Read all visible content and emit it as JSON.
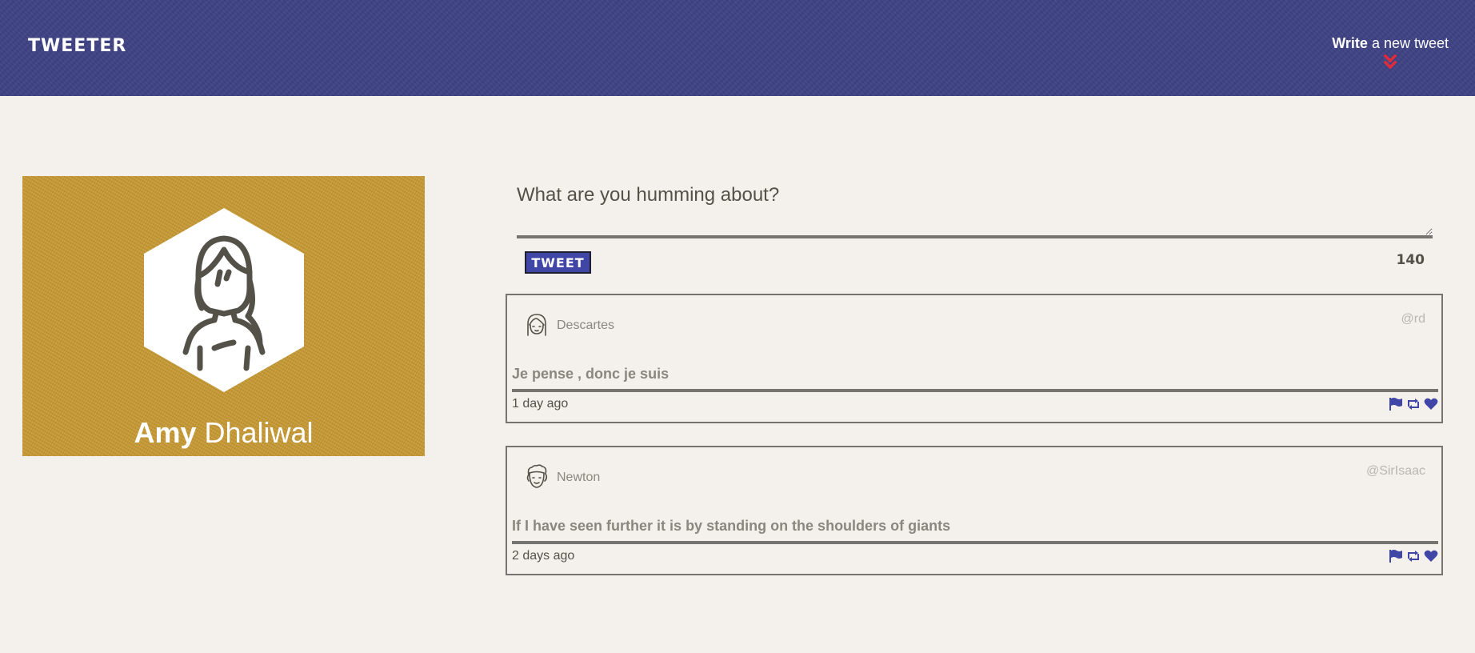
{
  "nav": {
    "brand": "TWEETER",
    "compose_bold": "Write",
    "compose_rest": " a new tweet",
    "compose_icon": "double-chevron-down-icon"
  },
  "profile": {
    "first_name": "Amy",
    "last_name": " Dhaliwal",
    "avatar_icon": "woman-avatar-icon"
  },
  "composer": {
    "placeholder": "What are you humming about?",
    "button_label": "TWEET",
    "counter": "140"
  },
  "tweets": [
    {
      "author": "Descartes",
      "handle": "@rd",
      "text": "Je pense , donc je suis",
      "time": "1 day ago",
      "avatar_icon": "girl-avatar-icon"
    },
    {
      "author": "Newton",
      "handle": "@SirIsaac",
      "text": "If I have seen further it is by standing on the shoulders of giants",
      "time": "2 days ago",
      "avatar_icon": "man-avatar-icon"
    }
  ],
  "action_icons": [
    "flag-icon",
    "retweet-icon",
    "heart-icon"
  ],
  "colors": {
    "nav_bg": "#3f4385",
    "profile_bg": "#c89a33",
    "accent": "#4046a6",
    "chevron": "#e02b3a",
    "page_bg": "#f4f1ed"
  }
}
